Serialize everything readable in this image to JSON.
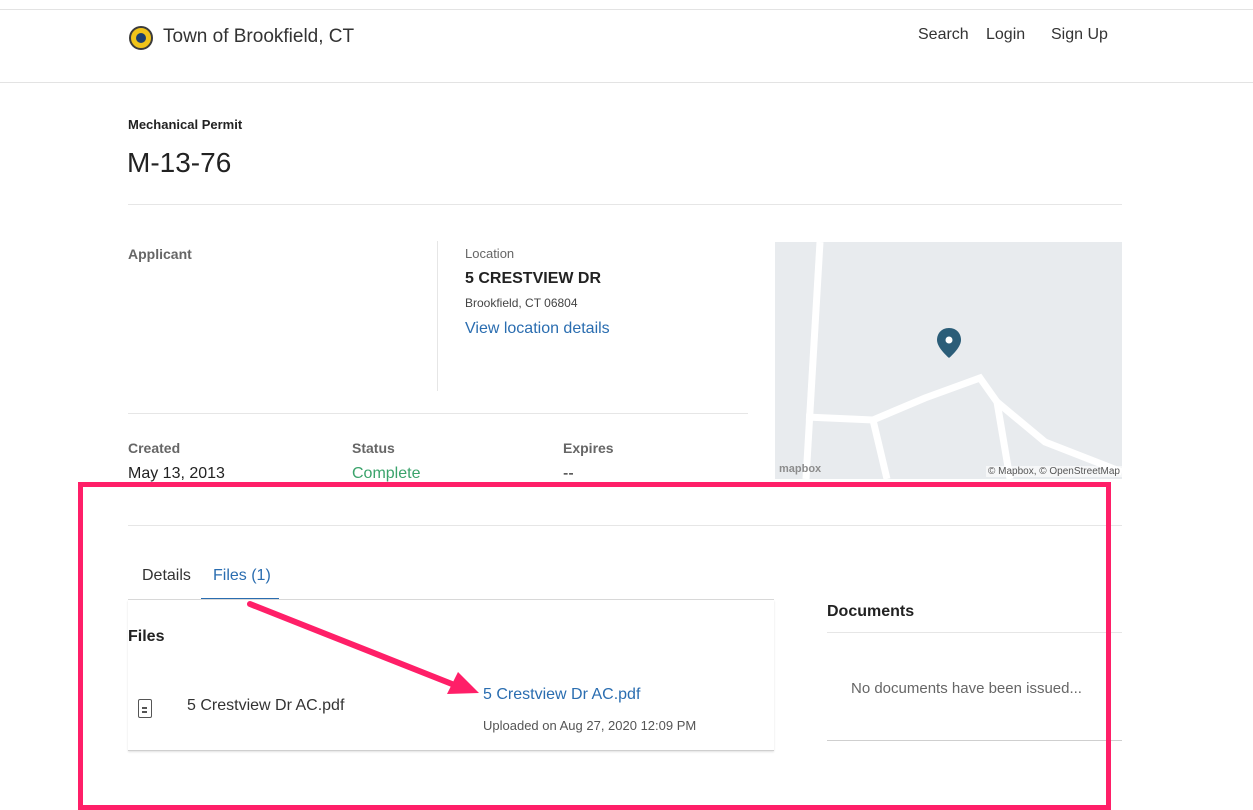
{
  "header": {
    "town_name": "Town of Brookfield, CT",
    "nav": {
      "search": "Search",
      "login": "Login",
      "signup": "Sign Up"
    }
  },
  "permit": {
    "type": "Mechanical Permit",
    "number": "M-13-76"
  },
  "applicant": {
    "label": "Applicant"
  },
  "location": {
    "label": "Location",
    "address": "5 CRESTVIEW DR",
    "city": "Brookfield, CT 06804",
    "details_link": "View location details"
  },
  "meta": {
    "created_label": "Created",
    "created_value": "May 13, 2013",
    "status_label": "Status",
    "status_value": "Complete",
    "expires_label": "Expires",
    "expires_value": "--"
  },
  "map": {
    "logo": "mapbox",
    "attribution": "© Mapbox, © OpenStreetMap"
  },
  "tabs": [
    {
      "label": "Details",
      "active": false
    },
    {
      "label": "Files (1)",
      "active": true
    }
  ],
  "files": {
    "heading": "Files",
    "items": [
      {
        "name": "5 Crestview Dr AC.pdf",
        "link": "5 Crestview Dr AC.pdf",
        "uploaded": "Uploaded on Aug 27, 2020 12:09 PM"
      }
    ]
  },
  "documents": {
    "heading": "Documents",
    "empty_text": "No documents have been issued..."
  },
  "colors": {
    "link": "#2a6db0",
    "status_complete": "#3aa36b",
    "annotation": "#ff1f68",
    "map_bg": "#e8ebee",
    "map_pin": "#2b5d78"
  }
}
